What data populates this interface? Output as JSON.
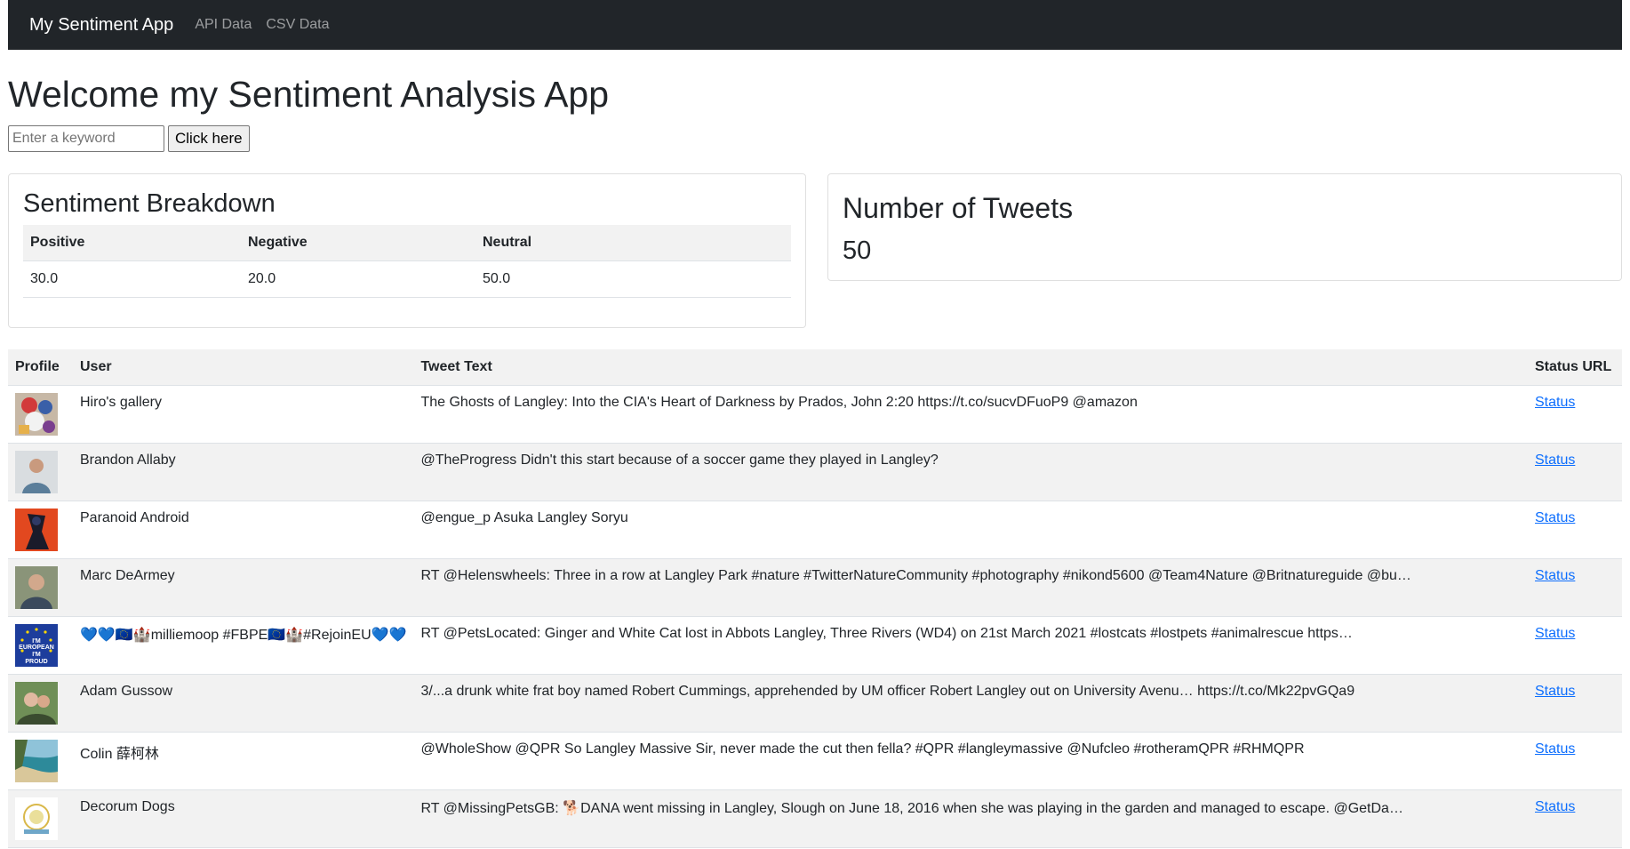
{
  "nav": {
    "brand": "My Sentiment App",
    "links": [
      "API Data",
      "CSV Data"
    ]
  },
  "heading": "Welcome my Sentiment Analysis App",
  "search": {
    "placeholder": "Enter a keyword",
    "value": "",
    "button": "Click here"
  },
  "sentiment": {
    "title": "Sentiment Breakdown",
    "headers": [
      "Positive",
      "Negative",
      "Neutral"
    ],
    "values": [
      "30.0",
      "20.0",
      "50.0"
    ]
  },
  "tweet_count": {
    "title": "Number of Tweets",
    "value": "50"
  },
  "tweets_table": {
    "headers": [
      "Profile",
      "User",
      "Tweet Text",
      "Status URL"
    ],
    "rows": [
      {
        "user": "Hiro's gallery",
        "text": "The Ghosts of Langley: Into the CIA's Heart of Darkness by Prados, John 2:20 https://t.co/sucvDFuoP9 @amazon",
        "status": "Status",
        "avatar": "avatar-collage"
      },
      {
        "user": "Brandon Allaby",
        "text": "@TheProgress Didn't this start because of a soccer game they played in Langley?",
        "status": "Status",
        "avatar": "avatar-person"
      },
      {
        "user": "Paranoid Android",
        "text": "@engue_p Asuka Langley Soryu",
        "status": "Status",
        "avatar": "avatar-red-figure"
      },
      {
        "user": "Marc DeArmey",
        "text": "RT @Helenswheels: Three in a row at Langley Park #nature #TwitterNatureCommunity #photography #nikond5600 @Team4Nature @Britnatureguide @bu…",
        "status": "Status",
        "avatar": "avatar-person"
      },
      {
        "user": "💙💙🇪🇺🏰milliemoop #FBPE🇪🇺🏰#RejoinEU💙💙",
        "text": "RT @PetsLocated: Ginger and White Cat lost in Abbots Langley, Three Rivers (WD4) on 21st March 2021 #lostcats #lostpets #animalrescue https…",
        "status": "Status",
        "avatar": "avatar-european",
        "avatar_text": "I'M EUROPEAN I'M PROUD"
      },
      {
        "user": "Adam Gussow",
        "text": "3/...a drunk white frat boy named Robert Cummings, apprehended by UM officer Robert Langley out on University Avenu… https://t.co/Mk22pvGQa9",
        "status": "Status",
        "avatar": "avatar-person"
      },
      {
        "user": "Colin 薛柯林",
        "text": "@WholeShow @QPR So Langley Massive Sir, never made the cut then fella? #QPR #langleymassive @Nufcleo #rotheramQPR #RHMQPR",
        "status": "Status",
        "avatar": "avatar-beach"
      },
      {
        "user": "Decorum Dogs",
        "text": "RT @MissingPetsGB: 🐕DANA went missing in Langley, Slough on June 18, 2016 when she was playing in the garden and managed to escape. @GetDa…",
        "status": "Status",
        "avatar": "avatar-logo"
      }
    ]
  },
  "colors": {
    "navbar": "#212529",
    "link": "#0d6efd",
    "stripe": "#f2f2f2"
  }
}
